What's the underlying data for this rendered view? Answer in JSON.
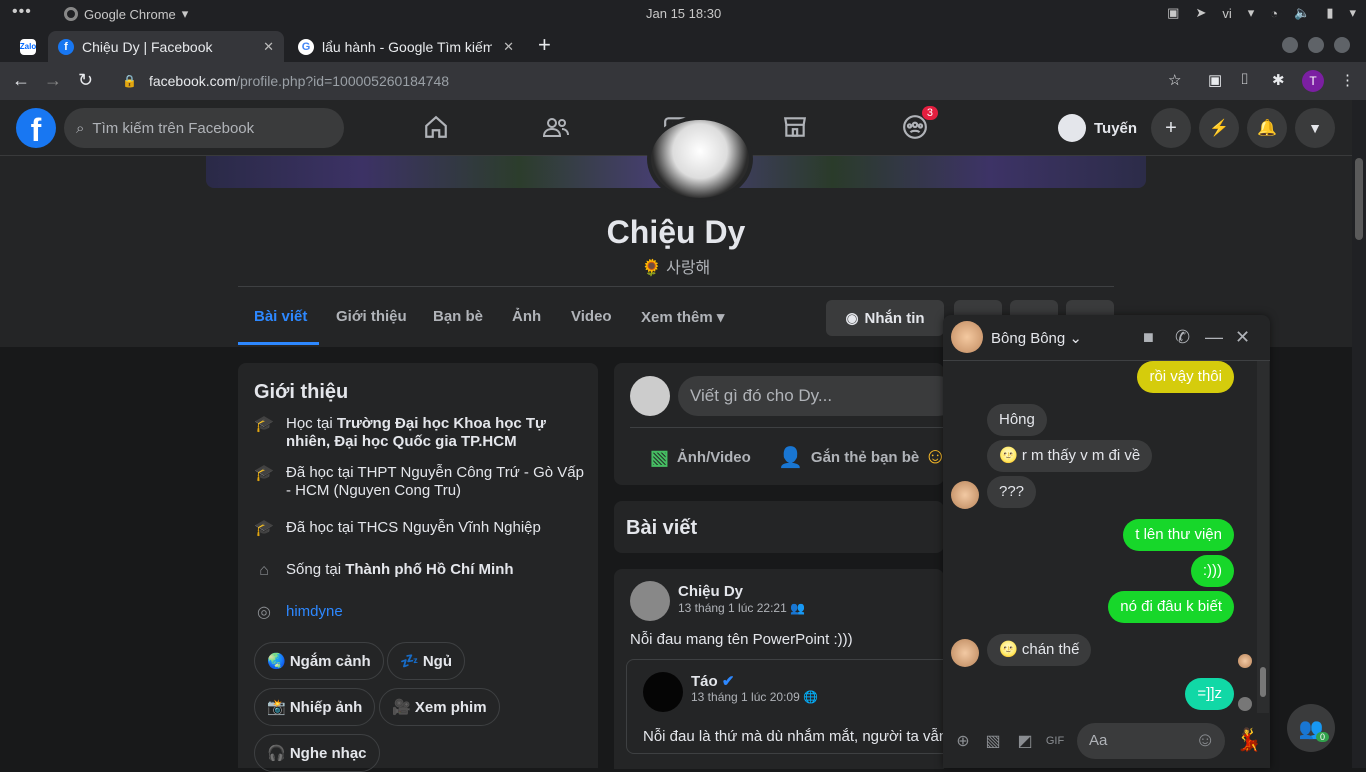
{
  "system": {
    "app": "Google Chrome",
    "datetime": "Jan 15  18:30",
    "lang": "vi"
  },
  "tabs": [
    {
      "title": "Zalo"
    },
    {
      "title": "Chiệu Dy | Facebook"
    },
    {
      "title": "lẩu hành - Google Tìm kiếm"
    }
  ],
  "address": {
    "host": "facebook.com",
    "path": "/profile.php?id=100005260184748",
    "profile_initial": "T"
  },
  "fb": {
    "search_placeholder": "Tìm kiếm trên Facebook",
    "groups_badge": "3",
    "user_name": "Tuyến"
  },
  "profile": {
    "name": "Chiệu Dy",
    "bio": "🌻 사랑해",
    "tabs": [
      "Bài viết",
      "Giới thiệu",
      "Bạn bè",
      "Ảnh",
      "Video",
      "Xem thêm"
    ],
    "message_button": "Nhắn tin"
  },
  "intro": {
    "title": "Giới thiệu",
    "rows": [
      {
        "prefix": "Học tại ",
        "bold": "Trường Đại học Khoa học Tự nhiên, Đại học Quốc gia TP.HCM",
        "icon": "graduation-cap-icon"
      },
      {
        "prefix": "Đã học tại THPT Nguyễn Công Trứ - Gò Vấp - HCM (Nguyen Cong Tru)",
        "bold": "",
        "icon": "graduation-cap-icon"
      },
      {
        "prefix": "Đã học tại THCS Nguyễn Vĩnh Nghiệp",
        "bold": "",
        "icon": "graduation-cap-icon"
      },
      {
        "prefix": "Sống tại ",
        "bold": "Thành phố Hồ Chí Minh",
        "icon": "home-icon"
      }
    ],
    "instagram": "himdyne",
    "hobbies": [
      "🌏 Ngắm cảnh",
      "💤 Ngủ",
      "📸 Nhiếp ảnh",
      "🎥 Xem phim",
      "🎧 Nghe nhạc"
    ]
  },
  "composer": {
    "placeholder": "Viết gì đó cho Dy...",
    "photo": "Ảnh/Video",
    "tag": "Gắn thẻ bạn bè"
  },
  "posts": {
    "header": "Bài viết",
    "author": "Chiệu Dy",
    "time": "13 tháng 1 lúc 22:21",
    "text": "Nỗi đau mang tên PowerPoint :)))",
    "shared_author": "Táo",
    "shared_time": "13 tháng 1 lúc 20:09",
    "shared_text": "Nỗi đau là thứ mà dù nhắm mắt, người ta vẫn khóc"
  },
  "chat": {
    "name": "Bông Bông",
    "input_placeholder": "Aa",
    "messages": [
      {
        "text": "rồi vậy thôi",
        "dir": "out"
      },
      {
        "text": "Hông",
        "dir": "in"
      },
      {
        "text": "r m thấy v m đi về",
        "dir": "in"
      },
      {
        "text": "???",
        "dir": "in"
      },
      {
        "text": "t lên thư viện",
        "dir": "out"
      },
      {
        "text": ":)))",
        "dir": "out"
      },
      {
        "text": "nó đi đâu k biết",
        "dir": "out"
      },
      {
        "text": "chán thế",
        "dir": "in"
      },
      {
        "text": "=]]z",
        "dir": "out"
      }
    ]
  },
  "colors": {
    "fb_blue": "#1877f2",
    "link_blue": "#2d88ff",
    "bg_dark": "#18191a",
    "surface": "#242526",
    "msg_green": "#17d72a"
  },
  "contacts_badge": "0"
}
